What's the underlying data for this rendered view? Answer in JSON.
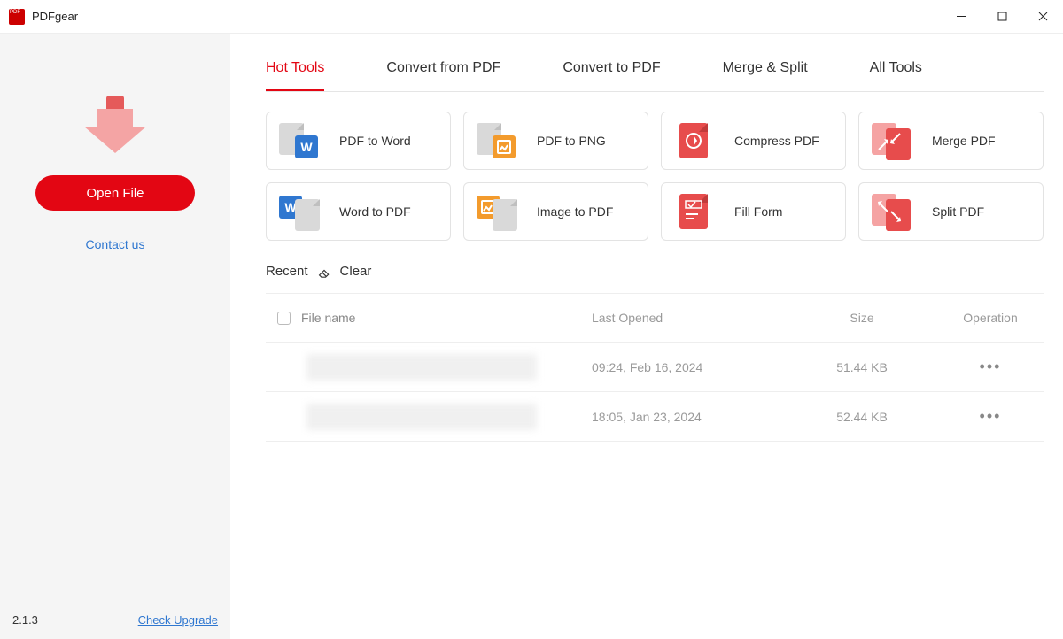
{
  "titlebar": {
    "app_name": "PDFgear"
  },
  "sidebar": {
    "open_file": "Open File",
    "contact": "Contact us",
    "version": "2.1.3",
    "upgrade": "Check Upgrade"
  },
  "tabs": {
    "hot_tools": "Hot Tools",
    "convert_from": "Convert from PDF",
    "convert_to": "Convert to PDF",
    "merge_split": "Merge & Split",
    "all_tools": "All Tools",
    "active": "hot_tools"
  },
  "tools": {
    "pdf_to_word": "PDF to Word",
    "pdf_to_png": "PDF to PNG",
    "compress_pdf": "Compress PDF",
    "merge_pdf": "Merge PDF",
    "word_to_pdf": "Word to PDF",
    "image_to_pdf": "Image to PDF",
    "fill_form": "Fill Form",
    "split_pdf": "Split PDF"
  },
  "recent": {
    "label": "Recent",
    "clear": "Clear",
    "headers": {
      "file_name": "File name",
      "last_opened": "Last Opened",
      "size": "Size",
      "operation": "Operation"
    },
    "rows": [
      {
        "last_opened": "09:24, Feb 16, 2024",
        "size": "51.44 KB"
      },
      {
        "last_opened": "18:05, Jan 23, 2024",
        "size": "52.44 KB"
      }
    ]
  }
}
